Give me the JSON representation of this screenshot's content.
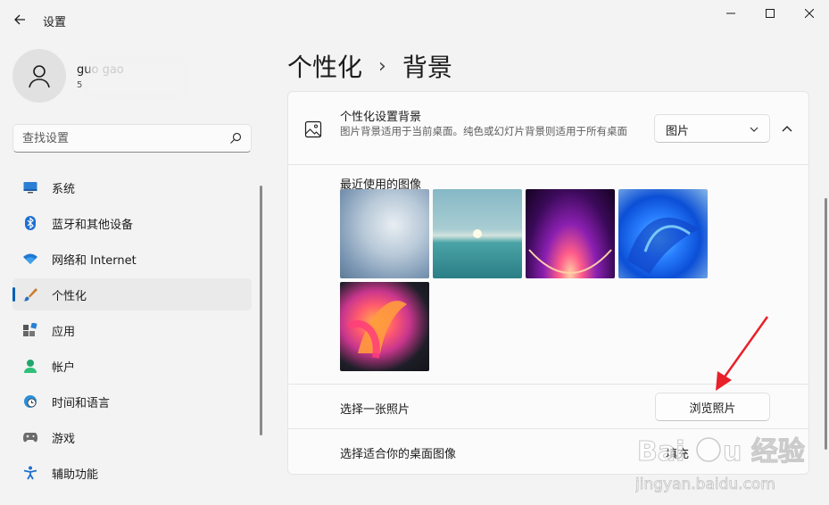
{
  "window": {
    "title": "设置"
  },
  "user": {
    "name": "guo gao",
    "email": "5"
  },
  "search": {
    "placeholder": "查找设置"
  },
  "sidebar": {
    "items": [
      {
        "label": "系统",
        "icon": "monitor-icon",
        "active": false
      },
      {
        "label": "蓝牙和其他设备",
        "icon": "bluetooth-icon",
        "active": false
      },
      {
        "label": "网络和 Internet",
        "icon": "wifi-icon",
        "active": false
      },
      {
        "label": "个性化",
        "icon": "brush-icon",
        "active": true
      },
      {
        "label": "应用",
        "icon": "apps-icon",
        "active": false
      },
      {
        "label": "帐户",
        "icon": "person-icon",
        "active": false
      },
      {
        "label": "时间和语言",
        "icon": "globe-clock-icon",
        "active": false
      },
      {
        "label": "游戏",
        "icon": "gamepad-icon",
        "active": false
      },
      {
        "label": "辅助功能",
        "icon": "accessibility-icon",
        "active": false
      }
    ]
  },
  "header": {
    "parent": "个性化",
    "separator": "›",
    "current": "背景"
  },
  "background": {
    "title": "个性化设置背景",
    "description": "图片背景适用于当前桌面。纯色或幻灯片背景则适用于所有桌面",
    "dropdown_value": "图片",
    "recent_label": "最近使用的图像",
    "recent_images": [
      "bloom-light",
      "lake-sunrise",
      "purple-glow",
      "blue-bloom",
      "colorful-ribbon"
    ],
    "browse_label": "选择一张照片",
    "browse_button": "浏览照片",
    "fit_label": "选择适合你的桌面图像",
    "fit_value": "填充"
  },
  "watermark": {
    "text": "Baidu 经验",
    "url": "jingyan.baidu.com"
  },
  "colors": {
    "accent": "#005fb8",
    "annotation_arrow": "#e8202a"
  }
}
